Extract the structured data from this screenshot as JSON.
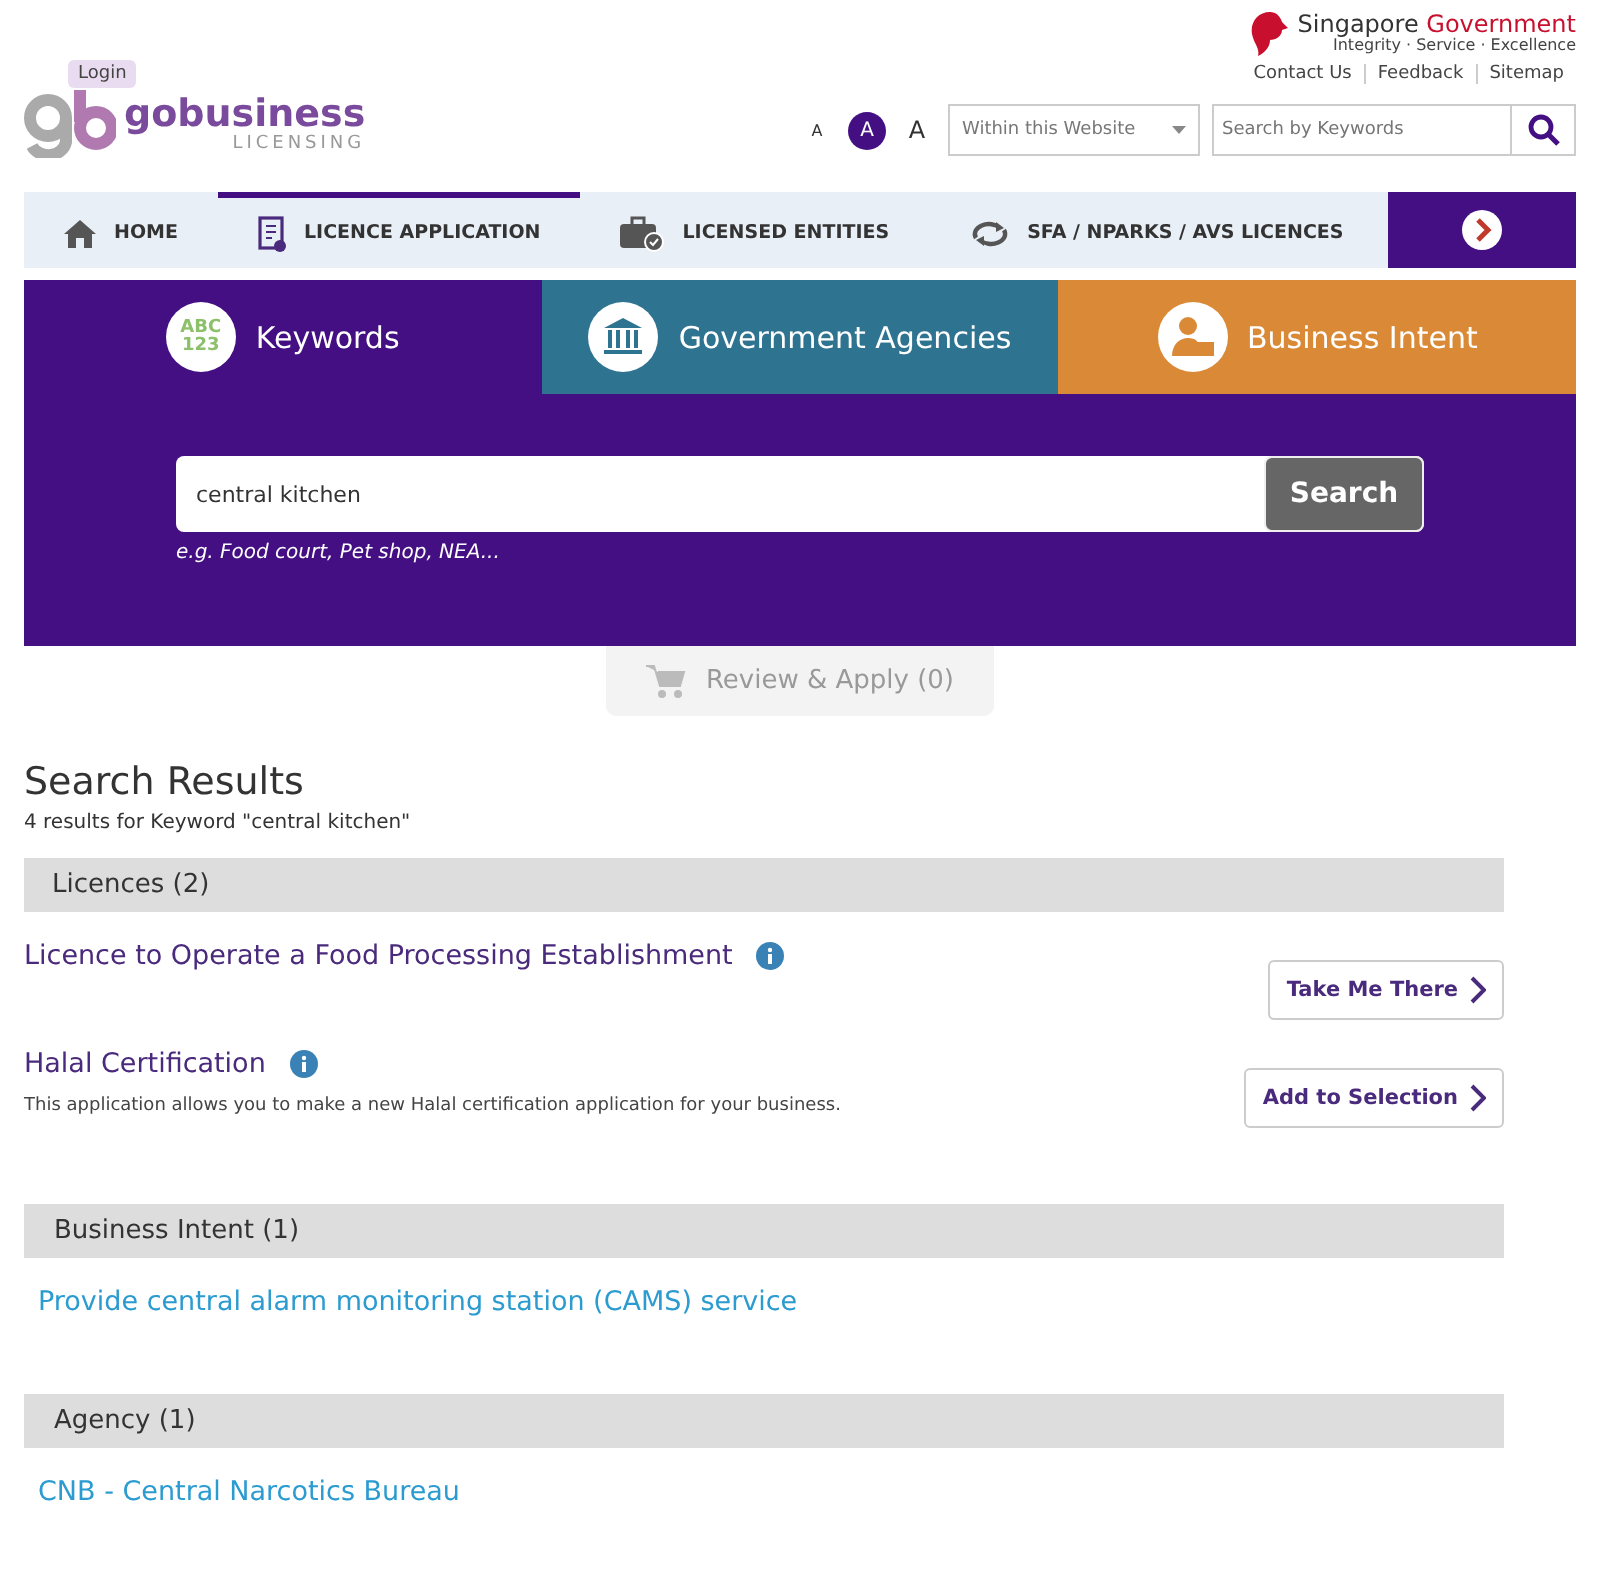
{
  "header": {
    "login": "Login",
    "brand": "gobusiness",
    "brand_sub": "LICENSING",
    "gov_name": "Singapore",
    "gov_name_accent": "Government",
    "gov_tagline": "Integrity · Service · Excellence",
    "links": [
      "Contact Us",
      "Feedback",
      "Sitemap"
    ],
    "font_sizes": [
      {
        "label": "A",
        "selected": false
      },
      {
        "label": "A",
        "selected": true
      },
      {
        "label": "A",
        "selected": false
      }
    ],
    "scope": "Within this Website",
    "search_placeholder": "Search by Keywords"
  },
  "nav": [
    {
      "label": "HOME",
      "selected": false
    },
    {
      "label": "LICENCE APPLICATION",
      "selected": true
    },
    {
      "label": "LICENSED ENTITIES",
      "selected": false
    },
    {
      "label": "SFA / NPARKS / AVS LICENCES",
      "selected": false
    }
  ],
  "search_tabs": [
    {
      "label": "Keywords",
      "icon_text": [
        "ABC",
        "123"
      ],
      "color": "#430f82"
    },
    {
      "label": "Government Agencies",
      "color": "#2e7390"
    },
    {
      "label": "Business Intent",
      "color": "#da8a36"
    }
  ],
  "search": {
    "value": "central kitchen",
    "button": "Search",
    "hint": "e.g. Food court, Pet shop, NEA..."
  },
  "review_button": "Review & Apply (0)",
  "results": {
    "title": "Search Results",
    "summary": "4 results for Keyword \"central kitchen\"",
    "sections": [
      {
        "title": "Licences (2)",
        "items": [
          {
            "kind": "licence",
            "title": "Licence to Operate a Food Processing Establishment",
            "button": "Take Me There"
          },
          {
            "kind": "licence",
            "title": "Halal Certification",
            "description": "This application allows you to make a new Halal certification application for your business.",
            "button": "Add to Selection"
          }
        ]
      },
      {
        "title": "Business Intent (1)",
        "items": [
          {
            "kind": "link",
            "title": "Provide central alarm monitoring station (CAMS) service"
          }
        ]
      },
      {
        "title": "Agency (1)",
        "items": [
          {
            "kind": "link",
            "title": "CNB - Central Narcotics Bureau"
          }
        ]
      }
    ]
  }
}
